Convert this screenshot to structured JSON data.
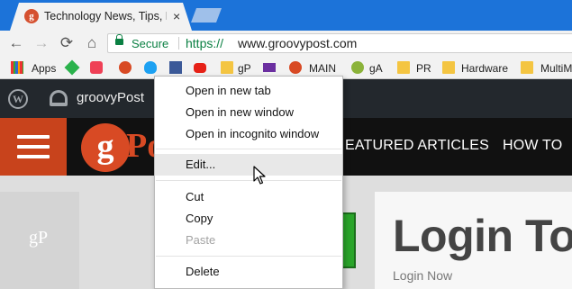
{
  "tab": {
    "favicon": "g",
    "title": "Technology News, Tips, R",
    "close": "×"
  },
  "nav": {
    "back": "←",
    "forward": "→",
    "reload": "⟳",
    "home": "⌂"
  },
  "omnibox": {
    "secure_label": "Secure",
    "url_scheme": "https://",
    "url_host": "www.groovypost.com"
  },
  "bookmarks": [
    {
      "label": "Apps",
      "icon": "apps-grid-icon"
    },
    {
      "label": "",
      "icon": "feedly-icon"
    },
    {
      "label": "",
      "icon": "pocket-icon"
    },
    {
      "label": "",
      "icon": "groovypost-icon"
    },
    {
      "label": "",
      "icon": "twitter-icon"
    },
    {
      "label": "",
      "icon": "facebook-icon"
    },
    {
      "label": "",
      "icon": "youtube-icon"
    },
    {
      "label": "gP",
      "icon": "folder-icon"
    },
    {
      "label": "",
      "icon": "mail-icon"
    },
    {
      "label": "MAIN",
      "icon": "groovypost-icon"
    },
    {
      "label": "gA",
      "icon": "groovy-android-icon"
    },
    {
      "label": "PR",
      "icon": "folder-icon"
    },
    {
      "label": "Hardware",
      "icon": "folder-icon"
    },
    {
      "label": "MultiM",
      "icon": "folder-icon"
    }
  ],
  "wpbar": {
    "wp_logo": "W",
    "site_name": "groovyPost"
  },
  "site": {
    "logo_g": "g",
    "logo_rest": "Po",
    "nav_featured": "EATURED ARTICLES",
    "nav_howto": "HOW TO"
  },
  "page": {
    "watermark": "gP",
    "login_title": "Login To",
    "login_sub": "Login Now"
  },
  "context_menu": {
    "open_new_tab": "Open in new tab",
    "open_new_window": "Open in new window",
    "open_incognito": "Open in incognito window",
    "edit": "Edit...",
    "cut": "Cut",
    "copy": "Copy",
    "paste": "Paste",
    "delete": "Delete"
  },
  "colors": {
    "chrome_frame": "#1c73d9",
    "secure_green": "#0b8043",
    "brand_orange": "#d84a24",
    "wp_bar": "#23282d",
    "menu_hover": "#e8e8e8"
  }
}
